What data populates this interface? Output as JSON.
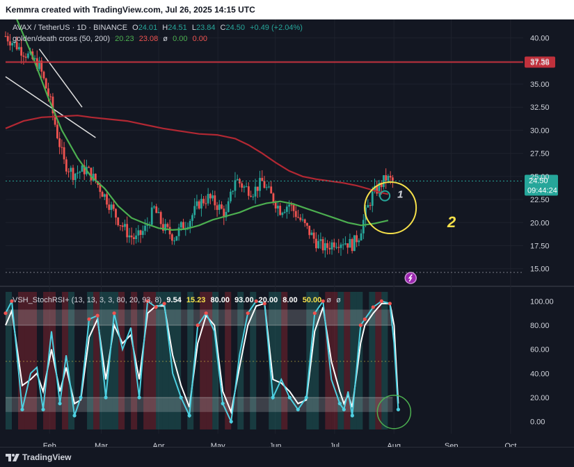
{
  "header": {
    "text": "Kemmra created with TradingView.com, Jul 26, 2025 14:15 UTC"
  },
  "footer": {
    "brand": "TradingView"
  },
  "legend_main": {
    "symbol": "AVAX / TetherUS · 1D · BINANCE",
    "o_label": "O",
    "o": "24.01",
    "h_label": "H",
    "h": "24.51",
    "l_label": "L",
    "l": "23.84",
    "c_label": "C",
    "c": "24.50",
    "change": "+0.49 (+2.04%)"
  },
  "legend_ma": {
    "name": "golden/death cross (50, 200)",
    "v1": "20.23",
    "v2": "23.08",
    "sym": "ø",
    "v3": "0.00",
    "v4": "0.00"
  },
  "legend_rsi": {
    "name": "VSH_StochRSI+ (13, 13, 3, 3, 80, 20, 93, 8)",
    "v1": "9.54",
    "v2": "15.23",
    "v3": "80.00",
    "v4": "93.00",
    "v5": "20.00",
    "v6": "8.00",
    "v7": "50.00",
    "v8": "ø",
    "v9": "ø"
  },
  "price_labels": {
    "resistance": "37.38",
    "current": "24.50",
    "countdown": "09:44:24"
  },
  "annotations": {
    "label1": "1",
    "label2": "2"
  },
  "colors": {
    "background": "#131722",
    "up": "#26a69a",
    "down": "#ef5350",
    "ma50": "#4caf50",
    "ma200": "#b22833",
    "resistance": "#c0313c",
    "circle_yellow": "#f5e04a",
    "circle_green": "#4caf50",
    "stoch_k": "#4dd0e1",
    "stoch_d": "#ffffff"
  },
  "chart_data": [
    {
      "type": "candlestick",
      "title": "AVAX / TetherUS 1D BINANCE",
      "y_ticks": [
        "40.00",
        "37.50",
        "35.00",
        "32.50",
        "30.00",
        "27.50",
        "25.00",
        "22.50",
        "20.00",
        "17.50",
        "15.00"
      ],
      "x_ticks": [
        "Feb",
        "Mar",
        "Apr",
        "May",
        "Jun",
        "Jul",
        "Aug",
        "Sep",
        "Oct"
      ],
      "ylim": [
        14,
        42
      ],
      "close_path": [
        [
          0,
          40.2
        ],
        [
          8,
          38.5
        ],
        [
          15,
          37.0
        ],
        [
          20,
          33.0
        ],
        [
          23,
          29.5
        ],
        [
          26,
          26.5
        ],
        [
          30,
          25.3
        ],
        [
          36,
          25.8
        ],
        [
          40,
          24.5
        ],
        [
          45,
          22.5
        ],
        [
          50,
          20.3
        ],
        [
          55,
          18.6
        ],
        [
          58,
          18.2
        ],
        [
          62,
          19.3
        ],
        [
          66,
          21.5
        ],
        [
          70,
          19.5
        ],
        [
          75,
          18.4
        ],
        [
          78,
          19.5
        ],
        [
          82,
          20.4
        ],
        [
          86,
          22.1
        ],
        [
          90,
          22.7
        ],
        [
          94,
          21.9
        ],
        [
          98,
          20.8
        ],
        [
          102,
          24.8
        ],
        [
          106,
          23.8
        ],
        [
          110,
          23.4
        ],
        [
          114,
          24.4
        ],
        [
          118,
          22.9
        ],
        [
          122,
          21.4
        ],
        [
          126,
          22.0
        ],
        [
          130,
          20.6
        ],
        [
          134,
          19.3
        ],
        [
          138,
          17.9
        ],
        [
          142,
          17.2
        ],
        [
          146,
          17.9
        ],
        [
          150,
          18.0
        ],
        [
          154,
          17.6
        ],
        [
          157,
          18.6
        ],
        [
          160,
          21.0
        ],
        [
          163,
          23.0
        ],
        [
          166,
          23.9
        ],
        [
          169,
          24.8
        ],
        [
          172,
          24.5
        ]
      ],
      "ma50_path": [
        [
          5,
          42
        ],
        [
          12,
          38
        ],
        [
          19,
          33.5
        ],
        [
          25,
          30
        ],
        [
          32,
          27
        ],
        [
          38,
          25
        ],
        [
          44,
          23.7
        ],
        [
          50,
          21.8
        ],
        [
          56,
          20.5
        ],
        [
          62,
          19.9
        ],
        [
          68,
          19.4
        ],
        [
          74,
          19.2
        ],
        [
          80,
          19.3
        ],
        [
          86,
          19.7
        ],
        [
          92,
          20.3
        ],
        [
          98,
          20.7
        ],
        [
          104,
          21.1
        ],
        [
          110,
          21.7
        ],
        [
          116,
          22.1
        ],
        [
          122,
          22.3
        ],
        [
          128,
          22.0
        ],
        [
          134,
          21.5
        ],
        [
          140,
          21.0
        ],
        [
          146,
          20.5
        ],
        [
          152,
          20.0
        ],
        [
          158,
          19.7
        ],
        [
          164,
          19.9
        ],
        [
          170,
          20.23
        ]
      ],
      "ma200_path": [
        [
          0,
          30.2
        ],
        [
          8,
          31.0
        ],
        [
          16,
          31.4
        ],
        [
          24,
          31.5
        ],
        [
          32,
          31.6
        ],
        [
          38,
          31.4
        ],
        [
          46,
          31.2
        ],
        [
          54,
          31.0
        ],
        [
          62,
          30.6
        ],
        [
          70,
          30.2
        ],
        [
          78,
          29.9
        ],
        [
          86,
          29.6
        ],
        [
          94,
          29.5
        ],
        [
          102,
          29.1
        ],
        [
          108,
          28.4
        ],
        [
          114,
          27.5
        ],
        [
          120,
          26.5
        ],
        [
          126,
          25.6
        ],
        [
          132,
          25.0
        ],
        [
          138,
          24.7
        ],
        [
          144,
          24.5
        ],
        [
          150,
          24.3
        ],
        [
          156,
          24.0
        ],
        [
          162,
          23.6
        ],
        [
          166,
          23.3
        ],
        [
          170,
          23.08
        ]
      ],
      "resistance_level": 37.38,
      "current_price": 24.5
    },
    {
      "type": "line",
      "title": "VSH_StochRSI+",
      "y_ticks": [
        "100.00",
        "80.00",
        "60.00",
        "40.00",
        "20.00",
        "0.00"
      ],
      "ylim": [
        -10,
        110
      ],
      "bands": [
        80,
        20
      ],
      "series": [
        {
          "name": "K",
          "values": [
            [
              0,
              90
            ],
            [
              3,
              100
            ],
            [
              8,
              10
            ],
            [
              12,
              40
            ],
            [
              15,
              45
            ],
            [
              18,
              10
            ],
            [
              22,
              75
            ],
            [
              26,
              15
            ],
            [
              29,
              55
            ],
            [
              33,
              5
            ],
            [
              36,
              20
            ],
            [
              40,
              85
            ],
            [
              44,
              88
            ],
            [
              48,
              20
            ],
            [
              52,
              90
            ],
            [
              56,
              60
            ],
            [
              60,
              78
            ],
            [
              64,
              20
            ],
            [
              68,
              100
            ],
            [
              72,
              95
            ],
            [
              76,
              98
            ],
            [
              80,
              40
            ],
            [
              84,
              20
            ],
            [
              88,
              5
            ],
            [
              92,
              80
            ],
            [
              96,
              90
            ],
            [
              100,
              75
            ],
            [
              104,
              15
            ],
            [
              108,
              0
            ],
            [
              112,
              55
            ],
            [
              116,
              90
            ],
            [
              120,
              100
            ],
            [
              124,
              98
            ],
            [
              128,
              20
            ],
            [
              132,
              35
            ],
            [
              136,
              20
            ],
            [
              140,
              10
            ],
            [
              144,
              20
            ],
            [
              148,
              90
            ],
            [
              152,
              100
            ],
            [
              156,
              35
            ],
            [
              160,
              15
            ],
            [
              162,
              10
            ],
            [
              164,
              25
            ],
            [
              166,
              5
            ],
            [
              170,
              80
            ],
            [
              172,
              85
            ],
            [
              176,
              95
            ],
            [
              180,
              100
            ],
            [
              184,
              98
            ],
            [
              186,
              65
            ],
            [
              188,
              10
            ]
          ]
        },
        {
          "name": "D",
          "values": [
            [
              0,
              80
            ],
            [
              3,
              92
            ],
            [
              8,
              30
            ],
            [
              12,
              35
            ],
            [
              15,
              40
            ],
            [
              18,
              25
            ],
            [
              22,
              60
            ],
            [
              26,
              25
            ],
            [
              29,
              45
            ],
            [
              33,
              15
            ],
            [
              36,
              18
            ],
            [
              40,
              70
            ],
            [
              44,
              85
            ],
            [
              48,
              35
            ],
            [
              52,
              80
            ],
            [
              56,
              65
            ],
            [
              60,
              72
            ],
            [
              64,
              35
            ],
            [
              68,
              90
            ],
            [
              72,
              96
            ],
            [
              76,
              96
            ],
            [
              80,
              55
            ],
            [
              84,
              30
            ],
            [
              88,
              12
            ],
            [
              92,
              65
            ],
            [
              96,
              88
            ],
            [
              100,
              80
            ],
            [
              104,
              25
            ],
            [
              108,
              8
            ],
            [
              112,
              45
            ],
            [
              116,
              80
            ],
            [
              120,
              96
            ],
            [
              124,
              98
            ],
            [
              128,
              35
            ],
            [
              132,
              32
            ],
            [
              136,
              25
            ],
            [
              140,
              15
            ],
            [
              144,
              18
            ],
            [
              148,
              75
            ],
            [
              152,
              95
            ],
            [
              156,
              50
            ],
            [
              160,
              25
            ],
            [
              162,
              15
            ],
            [
              164,
              22
            ],
            [
              166,
              12
            ],
            [
              170,
              65
            ],
            [
              172,
              80
            ],
            [
              176,
              90
            ],
            [
              180,
              98
            ],
            [
              184,
              98
            ],
            [
              186,
              80
            ],
            [
              188,
              15
            ]
          ]
        }
      ]
    }
  ]
}
